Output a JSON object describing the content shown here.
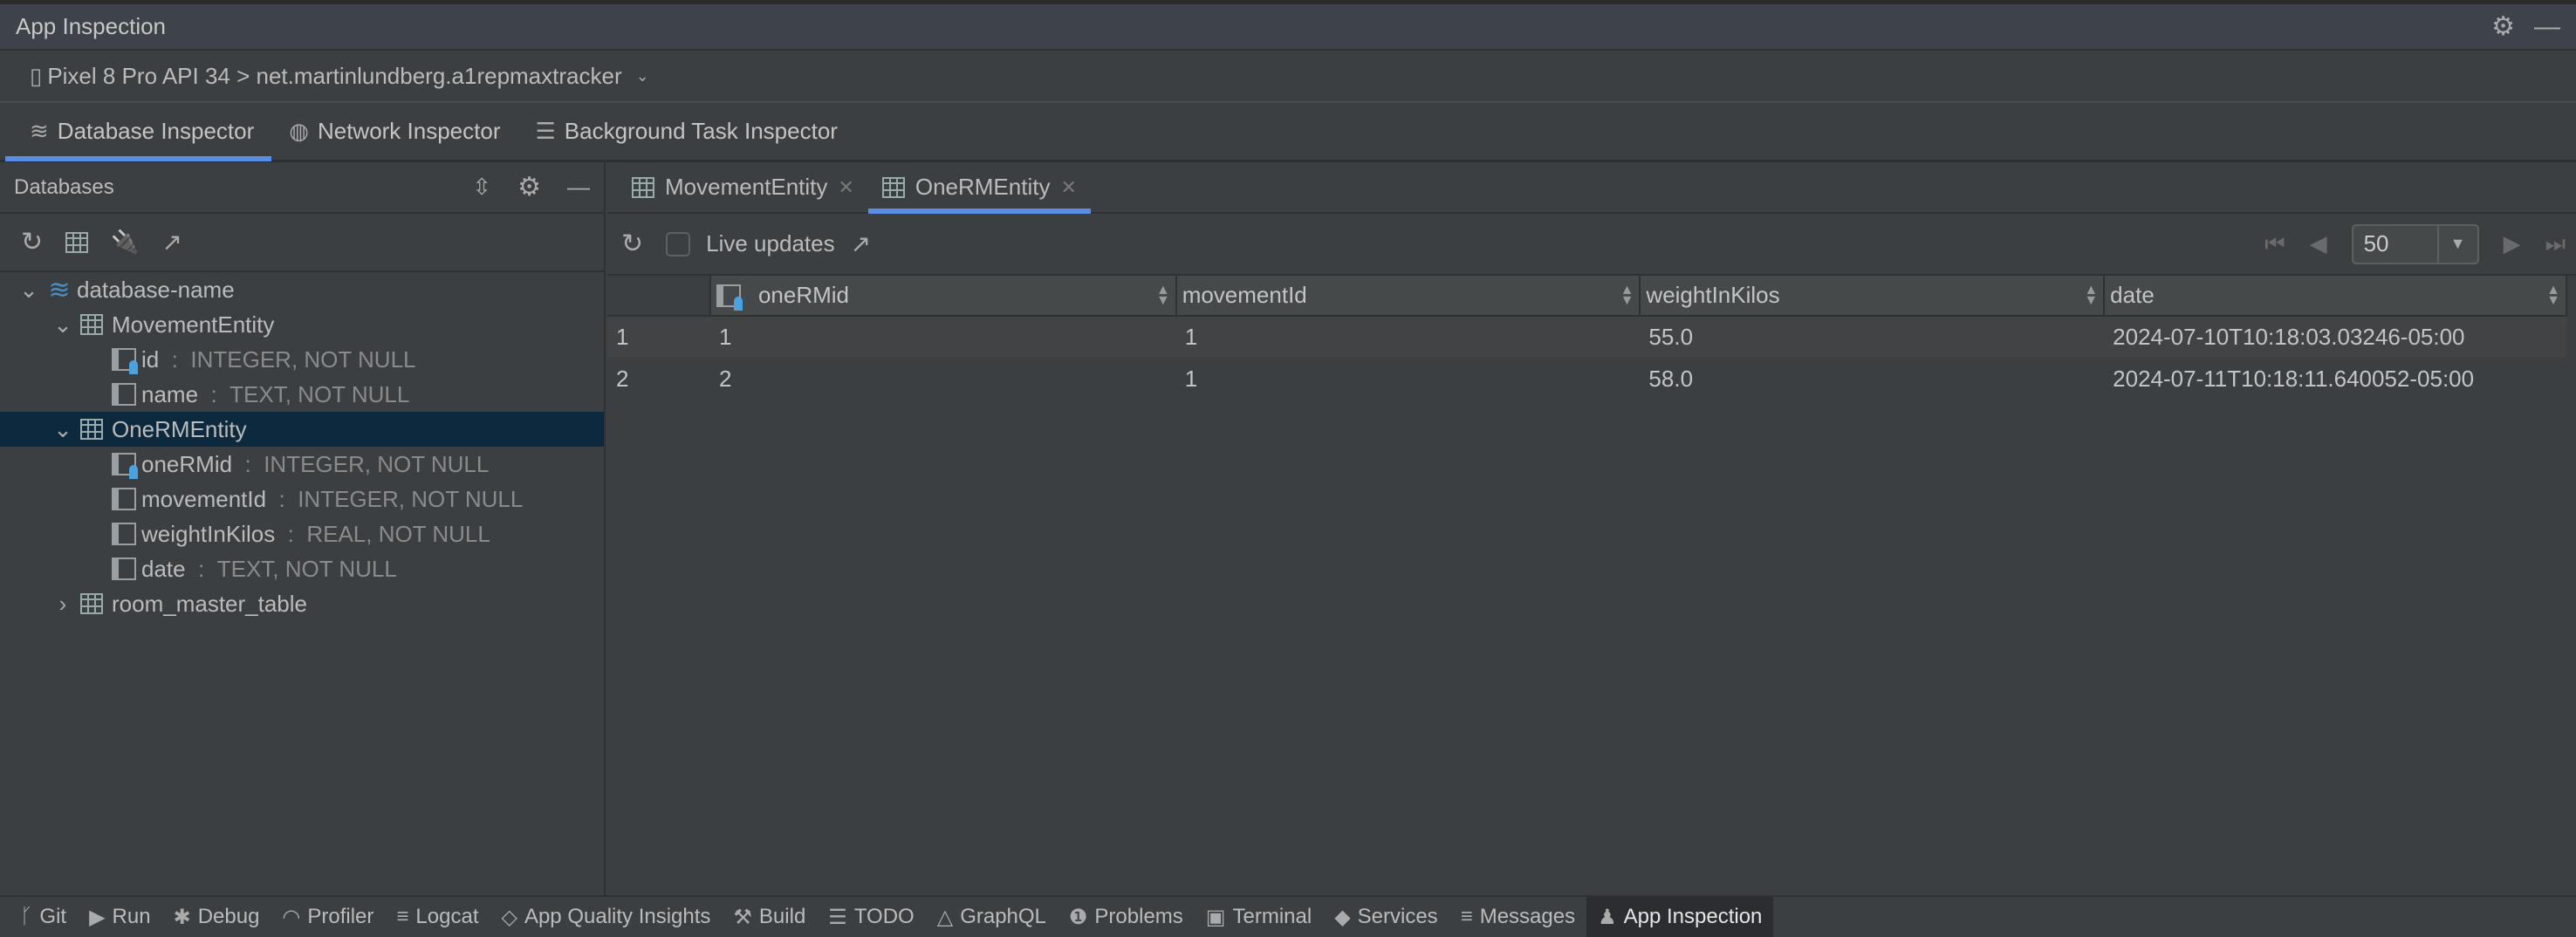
{
  "window": {
    "title": "App Inspection"
  },
  "device": {
    "label": "Pixel 8 Pro API 34 > net.martinlundberg.a1repmaxtracker"
  },
  "tabs": [
    {
      "label": "Database Inspector",
      "icon": "database-icon",
      "active": true
    },
    {
      "label": "Network Inspector",
      "icon": "globe-icon"
    },
    {
      "label": "Background Task Inspector",
      "icon": "list-icon"
    }
  ],
  "left": {
    "title": "Databases",
    "tree": [
      {
        "label": "database-name",
        "icon": "database-icon",
        "expanded": true
      },
      {
        "label": "MovementEntity",
        "icon": "table-icon",
        "expanded": true
      },
      {
        "label": "id",
        "type": "INTEGER, NOT NULL",
        "pk": true
      },
      {
        "label": "name",
        "type": "TEXT, NOT NULL"
      },
      {
        "label": "OneRMEntity",
        "icon": "table-icon",
        "expanded": true,
        "selected": true
      },
      {
        "label": "oneRMid",
        "type": "INTEGER, NOT NULL",
        "pk": true
      },
      {
        "label": "movementId",
        "type": "INTEGER, NOT NULL"
      },
      {
        "label": "weightInKilos",
        "type": "REAL, NOT NULL"
      },
      {
        "label": "date",
        "type": "TEXT, NOT NULL"
      },
      {
        "label": "room_master_table",
        "icon": "table-icon",
        "expanded": false
      }
    ]
  },
  "right": {
    "tabs": [
      {
        "label": "MovementEntity"
      },
      {
        "label": "OneRMEntity",
        "active": true
      }
    ],
    "live_updates": "Live updates",
    "live_checked": false,
    "page_size": "50",
    "columns": [
      "oneRMid",
      "movementId",
      "weightInKilos",
      "date"
    ],
    "rows": [
      {
        "n": "1",
        "cells": [
          "1",
          "1",
          "55.0",
          "2024-07-10T10:18:03.03246-05:00"
        ]
      },
      {
        "n": "2",
        "cells": [
          "2",
          "1",
          "58.0",
          "2024-07-11T10:18:11.640052-05:00"
        ]
      }
    ]
  },
  "bottom": [
    {
      "label": "Git",
      "icon": "git-branch-icon"
    },
    {
      "label": "Run",
      "icon": "run-icon"
    },
    {
      "label": "Debug",
      "icon": "bug-icon"
    },
    {
      "label": "Profiler",
      "icon": "profiler-icon"
    },
    {
      "label": "Logcat",
      "icon": "logcat-icon"
    },
    {
      "label": "App Quality Insights",
      "icon": "diamond-icon"
    },
    {
      "label": "Build",
      "icon": "hammer-icon"
    },
    {
      "label": "TODO",
      "icon": "list-icon"
    },
    {
      "label": "GraphQL",
      "icon": "graphql-icon"
    },
    {
      "label": "Problems",
      "icon": "alert-icon"
    },
    {
      "label": "Terminal",
      "icon": "terminal-icon"
    },
    {
      "label": "Services",
      "icon": "services-icon"
    },
    {
      "label": "Messages",
      "icon": "messages-icon"
    },
    {
      "label": "App Inspection",
      "icon": "inspection-icon",
      "active": true
    }
  ],
  "colors": {
    "accent": "#5a8ee6",
    "selection": "#0d293e",
    "key": "#4aa3df"
  }
}
